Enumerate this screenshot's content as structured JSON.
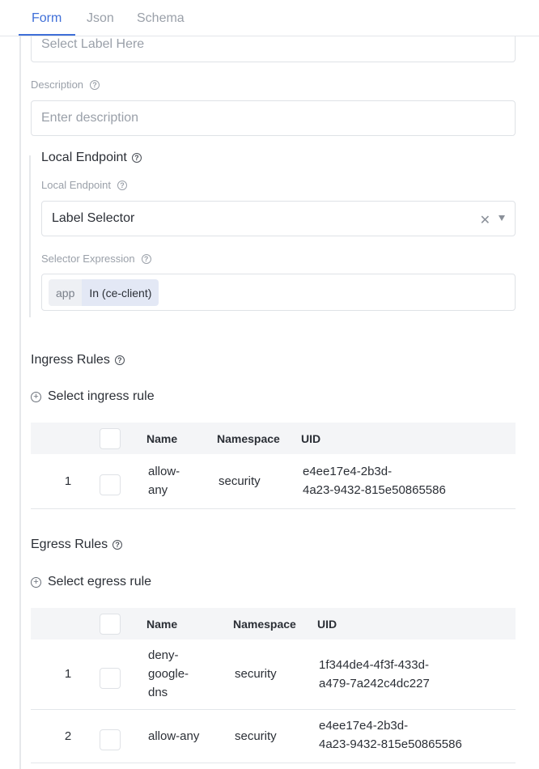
{
  "tabs": [
    {
      "label": "Form",
      "active": true
    },
    {
      "label": "Json",
      "active": false
    },
    {
      "label": "Schema",
      "active": false
    }
  ],
  "label_field": {
    "placeholder": "Select Label Here"
  },
  "description": {
    "label": "Description",
    "placeholder": "Enter description"
  },
  "local_endpoint": {
    "section_title": "Local Endpoint",
    "field_label": "Local Endpoint",
    "selected_value": "Label Selector",
    "selector_label": "Selector Expression",
    "chip_key": "app",
    "chip_value": "In (ce-client)"
  },
  "ingress": {
    "section_title": "Ingress Rules",
    "add_label": "Select ingress rule",
    "columns": {
      "name": "Name",
      "namespace": "Namespace",
      "uid": "UID"
    },
    "rows": [
      {
        "index": "1",
        "name_1": "allow-",
        "name_2": "any",
        "namespace": "security",
        "uid_1": "e4ee17e4-2b3d-",
        "uid_2": "4a23-9432-815e50865586"
      }
    ]
  },
  "egress": {
    "section_title": "Egress Rules",
    "add_label": "Select egress rule",
    "columns": {
      "name": "Name",
      "namespace": "Namespace",
      "uid": "UID"
    },
    "rows": [
      {
        "index": "1",
        "name_1": "deny-",
        "name_2": "google-",
        "name_3": "dns",
        "namespace": "security",
        "uid_1": "1f344de4-4f3f-433d-",
        "uid_2": "a479-7a242c4dc227"
      },
      {
        "index": "2",
        "name_1": "allow-any",
        "namespace": "security",
        "uid_1": "e4ee17e4-2b3d-",
        "uid_2": "4a23-9432-815e50865586"
      }
    ]
  },
  "colors": {
    "accent": "#3f6fd8",
    "border": "#dfe2e6",
    "muted_text": "#9aa0a9"
  }
}
